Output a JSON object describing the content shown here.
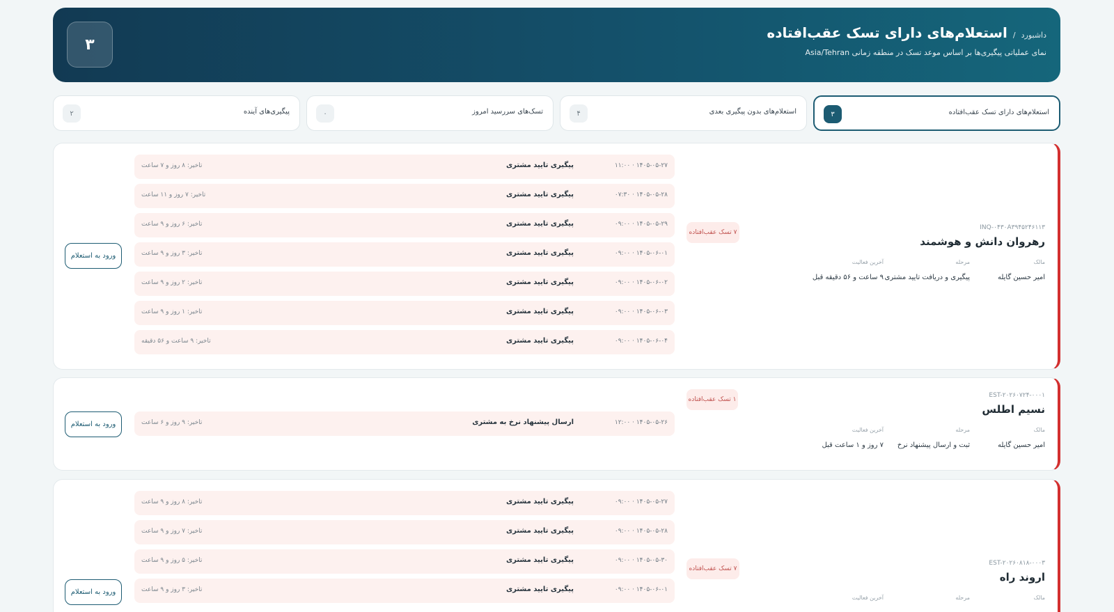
{
  "header": {
    "breadcrumb": "داشبورد",
    "breadcrumb_sep": "/",
    "title": "استعلام‌های دارای تسک عقب‌افتاده",
    "subtitle": "نمای عملیاتی پیگیری‌ها بر اساس موعد تسک در منطقه زمانی Asia/Tehran",
    "count": "۳"
  },
  "tabs": [
    {
      "label": "استعلام‌های دارای تسک عقب‌افتاده",
      "count": "۳",
      "active": true
    },
    {
      "label": "استعلام‌های بدون پیگیری بعدی",
      "count": "۴",
      "active": false
    },
    {
      "label": "تسک‌های سررسید امروز",
      "count": "۰",
      "active": false
    },
    {
      "label": "پیگیری‌های آینده",
      "count": "۲",
      "active": false
    }
  ],
  "labels": {
    "owner": "مالک",
    "stage": "مرحله",
    "last_activity": "آخرین فعالیت",
    "enter_button": "ورود به استعلام"
  },
  "inquiries": [
    {
      "id": "INQ-۰۴۳۰A۳۹۴۵۲۴۶۱۱۳",
      "company": "رهروان دانش و هوشمند",
      "owner": "امیر حسین گایله",
      "stage": "پیگیری و دریافت تایید مشتری",
      "last_activity": "۹ ساعت و ۵۶ دقیقه قبل",
      "overdue_badge": "۷ تسک عقب‌افتاده",
      "tasks": [
        {
          "time": "۱۴۰۵-۰۵-۲۷ · ۱۱:۰۰",
          "title": "پیگیری تایید مشتری",
          "delay": "تاخیر: ۸ روز و ۷ ساعت"
        },
        {
          "time": "۱۴۰۵-۰۵-۲۸ · ۰۷:۳۰",
          "title": "پیگیری تایید مشتری",
          "delay": "تاخیر: ۷ روز و ۱۱ ساعت"
        },
        {
          "time": "۱۴۰۵-۰۵-۲۹ · ۰۹:۰۰",
          "title": "پیگیری تایید مشتری",
          "delay": "تاخیر: ۶ روز و ۹ ساعت"
        },
        {
          "time": "۱۴۰۵-۰۶-۰۱ · ۰۹:۰۰",
          "title": "پیگیری تایید مشتری",
          "delay": "تاخیر: ۳ روز و ۹ ساعت"
        },
        {
          "time": "۱۴۰۵-۰۶-۰۲ · ۰۹:۰۰",
          "title": "پیگیری تایید مشتری",
          "delay": "تاخیر: ۲ روز و ۹ ساعت"
        },
        {
          "time": "۱۴۰۵-۰۶-۰۳ · ۰۹:۰۰",
          "title": "پیگیری تایید مشتری",
          "delay": "تاخیر: ۱ روز و ۹ ساعت"
        },
        {
          "time": "۱۴۰۵-۰۶-۰۴ · ۰۹:۰۰",
          "title": "پیگیری تایید مشتری",
          "delay": "تاخیر: ۹ ساعت و ۵۶ دقیقه"
        }
      ]
    },
    {
      "id": "EST-۲۰۲۶۰۷۲۴-۰۰۰۱",
      "company": "نسیم اطلس",
      "owner": "امیر حسین گایله",
      "stage": "ثبت و ارسال پیشنهاد نرخ",
      "last_activity": "۷ روز و ۱ ساعت قبل",
      "overdue_badge": "۱ تسک عقب‌افتاده",
      "tasks": [
        {
          "time": "۱۴۰۵-۰۵-۲۶ · ۱۲:۰۰",
          "title": "ارسال پیشنهاد نرخ به مشتری",
          "delay": "تاخیر: ۹ روز و ۶ ساعت"
        }
      ]
    },
    {
      "id": "EST-۲۰۲۶۰۸۱۸-۰۰۰۳",
      "company": "اروند راه",
      "owner": "",
      "stage": "",
      "last_activity": "",
      "overdue_badge": "۷ تسک عقب‌افتاده",
      "tasks": [
        {
          "time": "۱۴۰۵-۰۵-۲۷ · ۰۹:۰۰",
          "title": "پیگیری تایید مشتری",
          "delay": "تاخیر: ۸ روز و ۹ ساعت"
        },
        {
          "time": "۱۴۰۵-۰۵-۲۸ · ۰۹:۰۰",
          "title": "پیگیری تایید مشتری",
          "delay": "تاخیر: ۷ روز و ۹ ساعت"
        },
        {
          "time": "۱۴۰۵-۰۵-۳۰ · ۰۹:۰۰",
          "title": "پیگیری تایید مشتری",
          "delay": "تاخیر: ۵ روز و ۹ ساعت"
        },
        {
          "time": "۱۴۰۵-۰۶-۰۱ · ۰۹:۰۰",
          "title": "پیگیری تایید مشتری",
          "delay": "تاخیر: ۳ روز و ۹ ساعت"
        }
      ]
    }
  ],
  "colors": {
    "header_start": "#123a53",
    "header_end": "#15667b",
    "accent": "#1c5b72",
    "overdue": "#d32f2f",
    "task_bg": "#fdf1ef"
  }
}
